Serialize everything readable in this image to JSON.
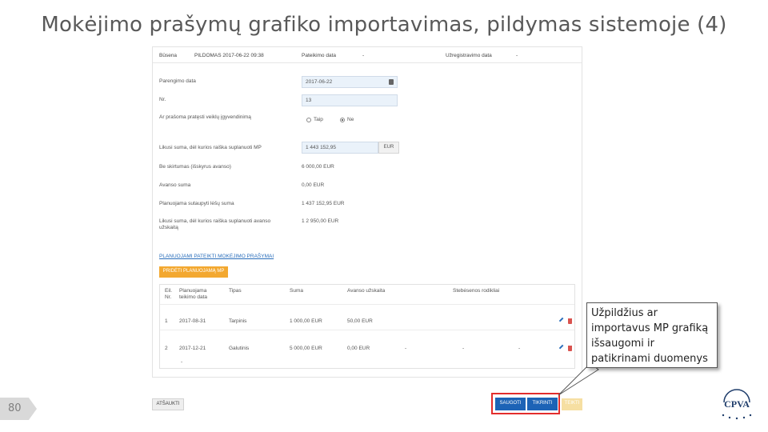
{
  "slide": {
    "title": "Mokėjimo prašymų grafiko importavimas, pildymas sistemoje (4)",
    "page_number": "80"
  },
  "topstrip": {
    "status_label": "Būsena",
    "status_value": "PILDOMAS 2017-06-22 09:38",
    "submitted_label": "Pateikimo data",
    "submitted_value": "-",
    "registered_label": "Užregistravimo data",
    "registered_value": "-"
  },
  "form": {
    "prep_date_label": "Parengimo data",
    "prep_date_value": "2017-06-22",
    "nr_label": "Nr.",
    "nr_value": "13",
    "extend_label": "Ar prašoma pratęsti veiklų įgyvendinimą",
    "radio_yes": "Taip",
    "radio_no": "Ne",
    "remaining_label": "Likusi suma, dėl kurios raiška suplanuoti MP",
    "remaining_value": "1 443 152,95",
    "remaining_unit": "EUR",
    "advance_excl_label": "Be skirtumas (išskyrus avanso)",
    "advance_excl_value": "6 000,00 EUR",
    "advance_label": "Avanso suma",
    "advance_value": "0,00 EUR",
    "planned_label": "Planuojama sutaupyti lėšų suma",
    "planned_value": "1 437 152,95 EUR",
    "remaining_adv_label": "Likusi suma, dėl kurios raiška suplanuoti avanso užskaitą",
    "remaining_adv_value": "1 2 950,00 EUR"
  },
  "section": {
    "link": "PLANUOJAMI PATEIKTI MOKĖJIMO PRAŠYMAI",
    "add_button": "PRIDĖTI PLANUOJAMĄ MP"
  },
  "table": {
    "headers": [
      "Eil. Nr.",
      "Planuojama teikimo data",
      "Tipas",
      "Suma",
      "Avanso užskaita",
      "Stebėsenos rodikliai"
    ],
    "rows": [
      {
        "nr": "1",
        "date": "2017-08-31",
        "type": "Tarpinis",
        "sum": "1 000,00 EUR",
        "advance": "50,00 EUR",
        "ind1": "",
        "ind2": "",
        "ind3": ""
      },
      {
        "nr": "2",
        "date": "2017-12-21",
        "type": "Galutinis",
        "sum": "5 000,00 EUR",
        "advance": "0,00 EUR",
        "ind1": "-",
        "ind2": "-",
        "ind3": "-"
      }
    ],
    "footer_dash": "-"
  },
  "buttons": {
    "cancel": "ATŠAUKTI",
    "save": "SAUGOTI",
    "check": "TIKRINTI",
    "submit": "TEIKTI"
  },
  "callout": {
    "text": "Užpildžius ar importavus MP grafiką išsaugomi ir patikrinami duomenys"
  },
  "logo": {
    "text": "CPVA"
  },
  "colors": {
    "primary_blue": "#1d63b6",
    "accent_orange": "#f3a830",
    "highlight_red": "#e32d2d",
    "link_blue": "#2a6ebb",
    "logo_navy": "#1f3d6b"
  }
}
